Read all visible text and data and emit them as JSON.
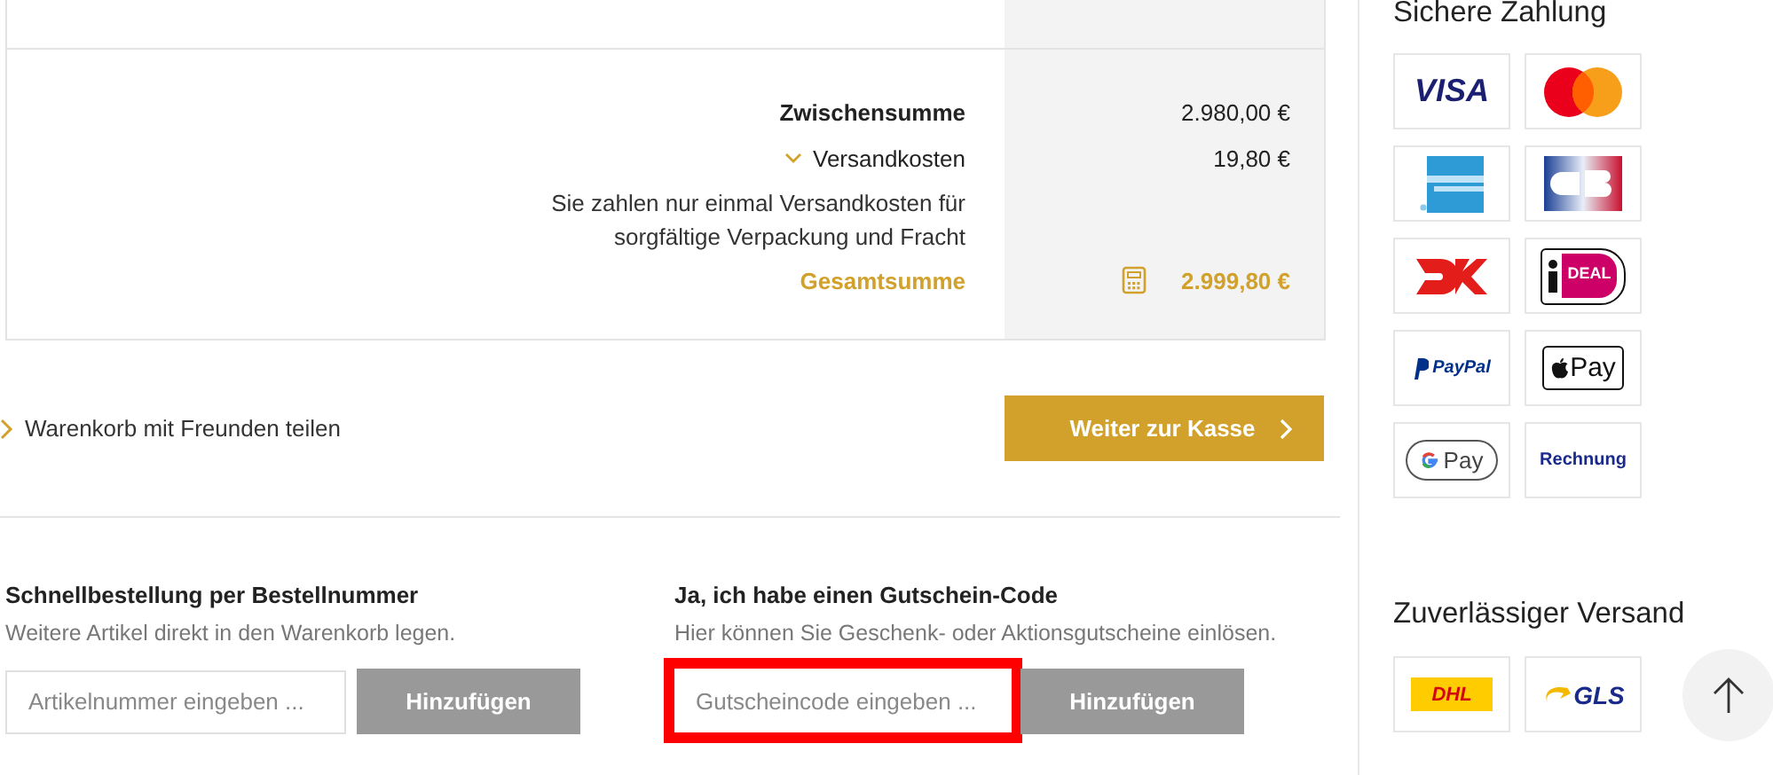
{
  "summary": {
    "rows": [
      {
        "kind": "subtotal",
        "label": "Zwischensumme",
        "value": "2.980,00 €"
      },
      {
        "kind": "shipping",
        "label": "Versandkosten",
        "value": "19,80 €",
        "expanded": true
      },
      {
        "kind": "note",
        "label": "Sie zahlen nur einmal Versandkosten für sorgfältige Verpackung und Fracht"
      },
      {
        "kind": "total",
        "label": "Gesamtsumme",
        "value": "2.999,80 €"
      }
    ]
  },
  "share_link": "Warenkorb mit Freunden teilen",
  "checkout_button": "Weiter zur Kasse",
  "forms": [
    {
      "title": "Schnellbestellung per Bestellnummer",
      "hint": "Weitere Artikel direkt in den Warenkorb legen.",
      "placeholder": "Artikelnummer eingeben ...",
      "button": "Hinzufügen",
      "highlighted": false
    },
    {
      "title": "Ja, ich habe einen Gutschein-Code",
      "hint": "Hier können Sie Geschenk- oder Aktionsgutscheine einlösen.",
      "placeholder": "Gutscheincode eingeben ...",
      "button": "Hinzufügen",
      "highlighted": true
    }
  ],
  "sidebar": {
    "payment_title": "Sichere Zahlung",
    "payment_methods": [
      {
        "kind": "visa",
        "text": "VISA"
      },
      {
        "kind": "mastercard"
      },
      {
        "kind": "amex"
      },
      {
        "kind": "cb"
      },
      {
        "kind": "dankort"
      },
      {
        "kind": "ideal",
        "text": "DEAL"
      },
      {
        "kind": "paypal",
        "text": "PayPal"
      },
      {
        "kind": "applepay",
        "text": "Pay"
      },
      {
        "kind": "googlepay",
        "text": "Pay"
      },
      {
        "kind": "invoice",
        "text": "Rechnung"
      }
    ],
    "shipping_title": "Zuverlässiger Versand",
    "shipping_methods": [
      {
        "kind": "dhl",
        "text": "DHL"
      },
      {
        "kind": "gls",
        "text": "GLS"
      }
    ]
  }
}
